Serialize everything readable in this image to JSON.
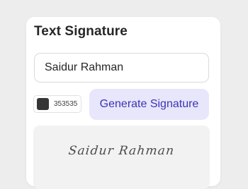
{
  "panel": {
    "title": "Text Signature"
  },
  "name_input": {
    "value": "Saidur Rahman"
  },
  "color_picker": {
    "hex": "353535",
    "color": "#353535"
  },
  "generate_button": {
    "label": "Generate Signature"
  },
  "preview": {
    "signature_text": "Saidur Rahman"
  },
  "colors": {
    "accent": "#3d33b4",
    "accent_bg": "#e7e6fb"
  }
}
